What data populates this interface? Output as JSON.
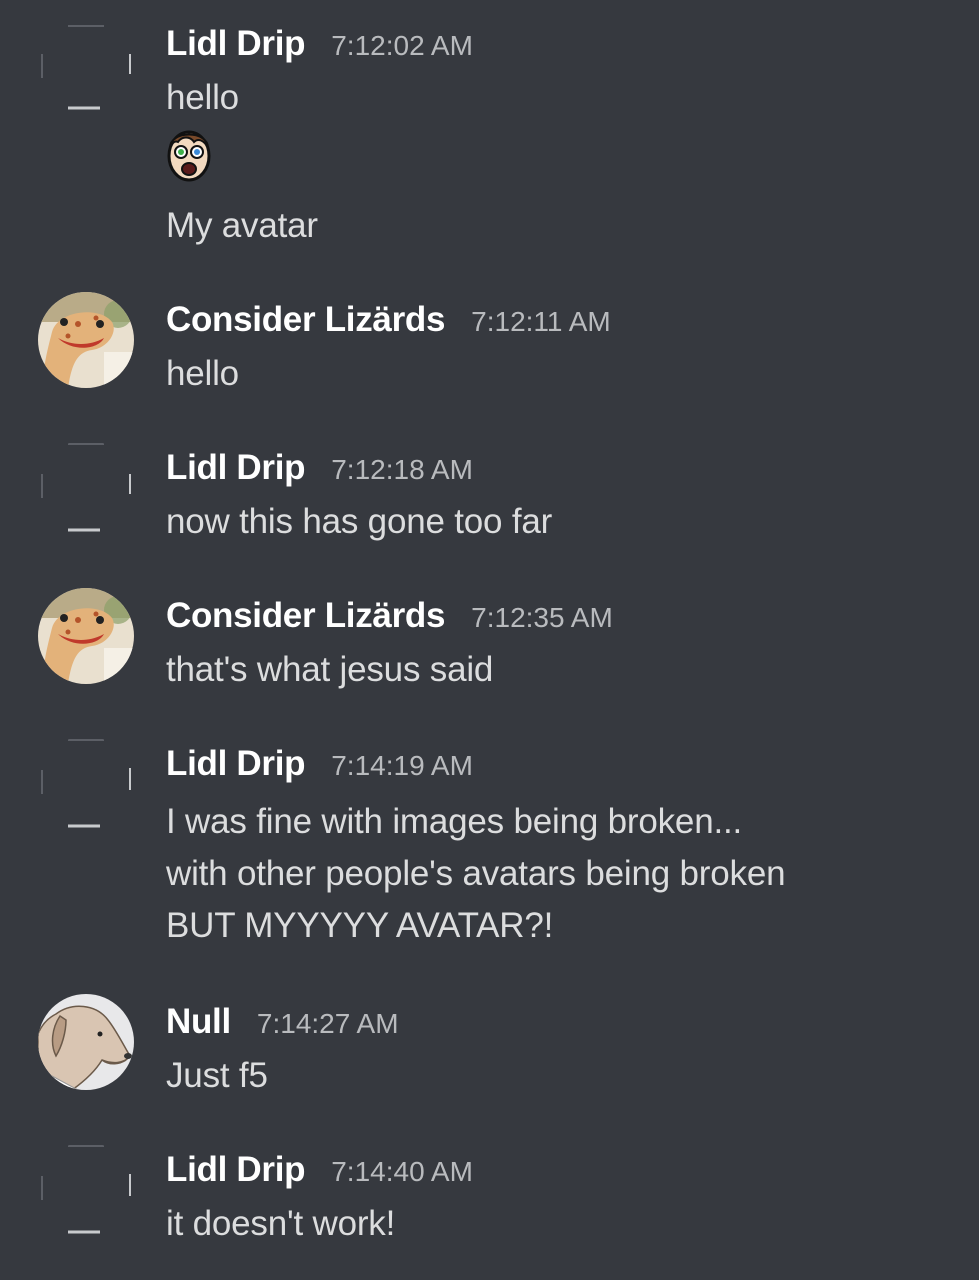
{
  "messages": [
    {
      "author": "Lidl Drip",
      "time": "7:12:02 AM",
      "avatar": "broken-avatar",
      "lines": [
        "hello",
        "My avatar"
      ],
      "attachment": "cartoon-face-image"
    },
    {
      "author": "Consider Lizärds",
      "time": "7:12:11 AM",
      "avatar": "lizard-avatar",
      "lines": [
        "hello"
      ]
    },
    {
      "author": "Lidl Drip",
      "time": "7:12:18 AM",
      "avatar": "broken-avatar",
      "lines": [
        "now this has gone too far"
      ]
    },
    {
      "author": "Consider Lizärds",
      "time": "7:12:35 AM",
      "avatar": "lizard-avatar",
      "lines": [
        "that's what jesus said"
      ]
    },
    {
      "author": "Lidl Drip",
      "time": "7:14:19 AM",
      "avatar": "broken-avatar",
      "lines": [
        "I was fine with images being broken...",
        "with other people's avatars being broken",
        "BUT MYYYYY AVATAR?!"
      ]
    },
    {
      "author": "Null",
      "time": "7:14:27 AM",
      "avatar": "dog-avatar",
      "lines": [
        "Just f5"
      ]
    },
    {
      "author": "Lidl Drip",
      "time": "7:14:40 AM",
      "avatar": "broken-avatar",
      "lines": [
        "it doesn't work!"
      ]
    }
  ],
  "colors": {
    "background": "#36393f",
    "author": "#ffffff",
    "text": "#dcddde",
    "timestamp": "#b9bbbe"
  }
}
